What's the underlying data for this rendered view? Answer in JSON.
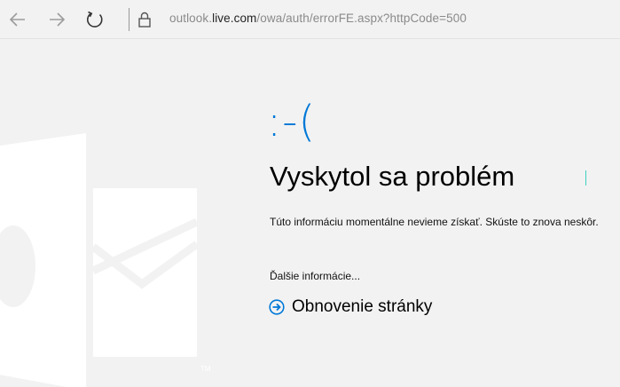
{
  "browser": {
    "url_prefix": "outlook.",
    "url_host": "live.com",
    "url_path": "/owa/auth/errorFE.aspx?httpCode=500",
    "back_icon": "back-arrow-icon",
    "forward_icon": "forward-arrow-icon",
    "refresh_icon": "refresh-icon",
    "lock_icon": "lock-icon"
  },
  "error": {
    "emoticon": ":-(",
    "title": "Vyskytol sa problém",
    "message": "Túto informáciu momentálne nevieme získať. Skúste to znova neskôr.",
    "more_info": "Ďalšie informácie...",
    "refresh_label": "Obnovenie stránky"
  },
  "colors": {
    "accent": "#0078d7",
    "background": "#f2f2f2",
    "watermark": "#ffffff"
  }
}
